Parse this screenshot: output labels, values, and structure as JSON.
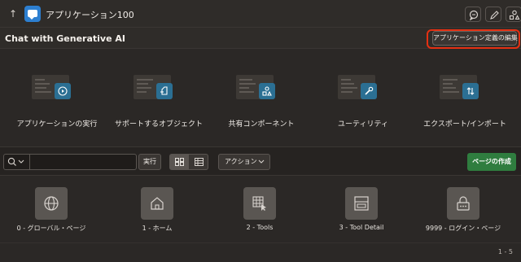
{
  "app": {
    "title": "アプリケーション100"
  },
  "header": {
    "title": "Chat with Generative AI",
    "edit_button": "アプリケーション定義の編集"
  },
  "cards": [
    {
      "label": "アプリケーションの実行",
      "icon": "play-icon"
    },
    {
      "label": "サポートするオブジェクト",
      "icon": "document-icon"
    },
    {
      "label": "共有コンポーネント",
      "icon": "shapes-icon"
    },
    {
      "label": "ユーティリティ",
      "icon": "wrench-icon"
    },
    {
      "label": "エクスポート/インポート",
      "icon": "arrows-updown-icon"
    }
  ],
  "toolbar": {
    "search_value": "",
    "run_label": "実行",
    "action_label": "アクション",
    "create_label": "ページの作成"
  },
  "pages": [
    {
      "label": "0 - グローバル・ページ",
      "icon": "globe-icon"
    },
    {
      "label": "1 - ホーム",
      "icon": "home-icon"
    },
    {
      "label": "2 - Tools",
      "icon": "grid-pointer-icon"
    },
    {
      "label": "3 - Tool Detail",
      "icon": "form-icon"
    },
    {
      "label": "9999 - ログイン・ページ",
      "icon": "lock-icon"
    }
  ],
  "footer": {
    "count": "1 - 5"
  },
  "colors": {
    "background": "#2b2826",
    "accent_blue": "#2d7fd0",
    "badge_teal": "#2b6f93",
    "create_green": "#2f7d3f",
    "highlight_red": "#e53012"
  }
}
